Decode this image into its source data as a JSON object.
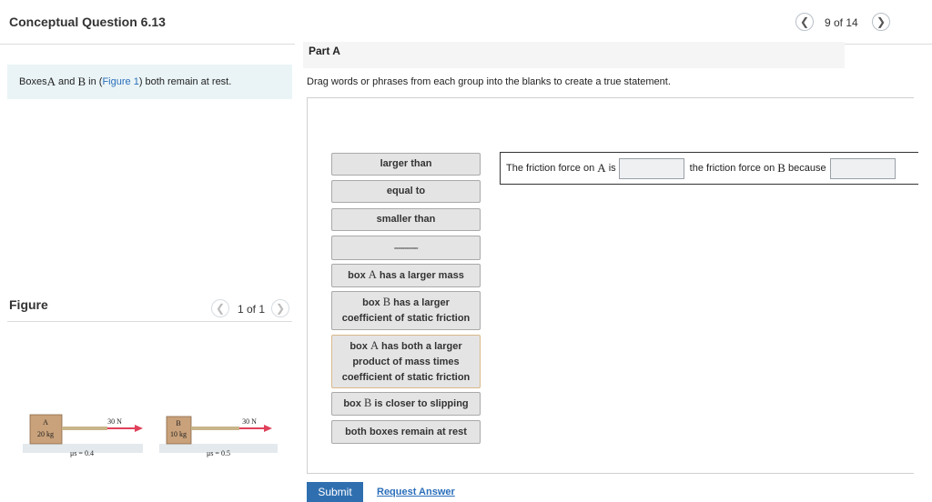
{
  "header": {
    "title": "Conceptual Question 6.13",
    "counter": "9 of 14"
  },
  "context": {
    "pre": "Boxes ",
    "a": "A",
    "and": " and ",
    "b": "B",
    "in": " in (",
    "link": "Figure 1",
    "post": ") both remain at rest."
  },
  "figure": {
    "label": "Figure",
    "counter": "1 of 1",
    "box_a": {
      "name": "A",
      "mass": "20 kg",
      "force": "30 N",
      "mu": "μs = 0.4",
      "color": "#c9a17a"
    },
    "box_b": {
      "name": "B",
      "mass": "10 kg",
      "force": "30 N",
      "mu": "μs = 0.5",
      "color": "#c9a17a"
    }
  },
  "part": {
    "label": "Part A",
    "instructions": "Drag words or phrases from each group into the blanks to create a true statement."
  },
  "chips": [
    {
      "pre": "larger than"
    },
    {
      "pre": "equal to"
    },
    {
      "pre": "smaller than"
    },
    {
      "pre": "------------"
    },
    {
      "pre": "box ",
      "sym": "A",
      "post": " has a larger mass"
    },
    {
      "pre": "box ",
      "sym": "B",
      "post": " has a larger",
      "line2": "coefficient of static friction"
    },
    {
      "pre": "box ",
      "sym": "A",
      "post": " has both a larger",
      "line2": "product of mass times",
      "line3": "coefficient of static friction"
    },
    {
      "pre": "box ",
      "sym": "B",
      "post": " is closer to slipping"
    },
    {
      "pre": "both boxes remain at rest"
    }
  ],
  "sentence": {
    "p1": "The friction force on ",
    "a": "A",
    "p1b": " is",
    "p2": "the friction force on ",
    "b": "B",
    "p2b": " because"
  },
  "actions": {
    "submit": "Submit",
    "request": "Request Answer"
  },
  "colors": {
    "accent": "#2f6fb0",
    "link": "#2a6ebb",
    "arrow": "#e0405a",
    "rope": "#c8b58a"
  }
}
